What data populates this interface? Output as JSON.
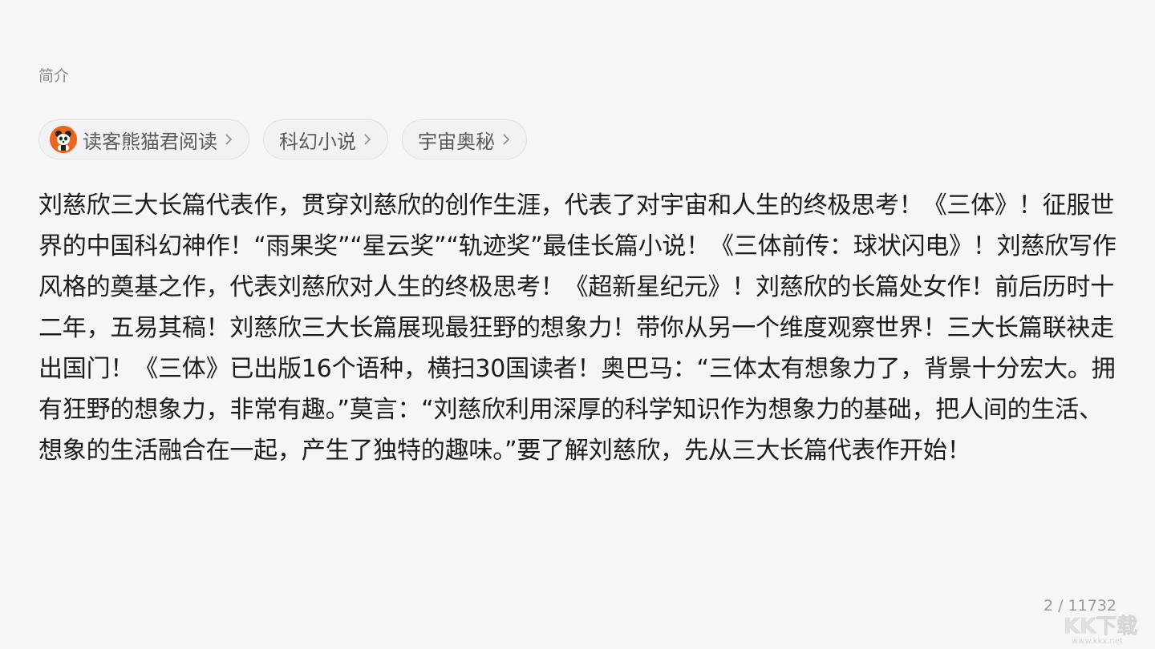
{
  "intro": {
    "section_label": "简介"
  },
  "tags": [
    {
      "label": "读客熊猫君阅读",
      "icon": "panda-avatar-icon"
    },
    {
      "label": "科幻小说"
    },
    {
      "label": "宇宙奥秘"
    }
  ],
  "description": "刘慈欣三大长篇代表作，贯穿刘慈欣的创作生涯，代表了对宇宙和人生的终极思考！《三体》！征服世界的中国科幻神作！“雨果奖”“星云奖”“轨迹奖”最佳长篇小说！《三体前传：球状闪电》！刘慈欣写作风格的奠基之作，代表刘慈欣对人生的终极思考！《超新星纪元》！刘慈欣的长篇处女作！前后历时十二年，五易其稿！刘慈欣三大长篇展现最狂野的想象力！带你从另一个维度观察世界！三大长篇联袂走出国门！《三体》已出版16个语种，横扫30国读者！奥巴马：“三体太有想象力了，背景十分宏大。拥有狂野的想象力，非常有趣。”莫言：“刘慈欣利用深厚的科学知识作为想象力的基础，把人间的生活、想象的生活融合在一起，产生了独特的趣味。”要了解刘慈欣，先从三大长篇代表作开始！",
  "footer": {
    "page_counter": "2 / 11732"
  },
  "watermark": {
    "text": "KK下载",
    "url_text": "www.kkx.net"
  },
  "colors": {
    "background": "#f6f6f8",
    "tag_background": "#f2f2f4",
    "avatar": "#e8661f"
  }
}
